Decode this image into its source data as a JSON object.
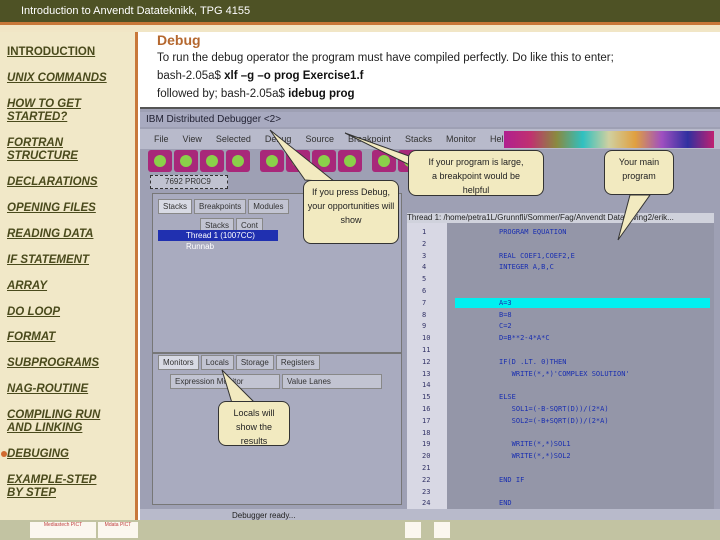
{
  "header": {
    "title": "Introduction to Anvendt Datateknikk, TPG 4155"
  },
  "sidebar": {
    "items": [
      "INTRODUCTION",
      "UNIX COMMANDS",
      "HOW TO GET STARTED?",
      "FORTRAN STRUCTURE",
      "DECLARATIONS",
      "OPENING FILES",
      "READING DATA",
      "IF STATEMENT",
      "ARRAY",
      "DO LOOP",
      "FORMAT",
      "SUBPROGRAMS",
      "NAG-ROUTINE",
      "COMPILING RUN AND LINKING",
      "DEBUGING",
      "EXAMPLE-STEP BY STEP"
    ],
    "active": "DEBUGING"
  },
  "main": {
    "title": "Debug",
    "line1": "To run the debug operator the program must have compiled perfectly. Do like this to enter;",
    "line2_prefix": "bash-2.05a$ ",
    "line2_cmd": "xlf –g –o prog Exercise1.f",
    "line3_prefix": "followed by; bash-2.05a$ ",
    "line3_cmd": "idebug prog"
  },
  "debugger": {
    "title": "IBM Distributed Debugger <2>",
    "menu": [
      "File",
      "View",
      "Selected",
      "Debug",
      "Source",
      "Breakpoint",
      "Stacks",
      "Monitor",
      "Help"
    ],
    "process": "7692 PR0C9",
    "left_tabs": [
      "Stacks",
      "Breakpoints",
      "Modules"
    ],
    "stack_cols": [
      "Stacks",
      "Cont"
    ],
    "thread": "Thread 1 (1007CC) Runnab",
    "bottom_tabs": [
      "Monitors",
      "Locals",
      "Storage",
      "Registers"
    ],
    "monitor_cols": [
      "Expression Monitor",
      "Value Lanes"
    ],
    "path": "Thread 1: /home/petra1L/Grunnfli/Sommer/Fag/Anvendt Data/Oving2/erik...",
    "code": [
      [
        "1",
        "PROGRAM EQUATION"
      ],
      [
        "2",
        ""
      ],
      [
        "3",
        "REAL COEF1,COEF2,E"
      ],
      [
        "4",
        "INTEGER A,B,C"
      ],
      [
        "5",
        ""
      ],
      [
        "6",
        ""
      ],
      [
        "7",
        "A=3"
      ],
      [
        "8",
        "B=8"
      ],
      [
        "9",
        "C=2"
      ],
      [
        "10",
        "D=B**2-4*A*C"
      ],
      [
        "11",
        ""
      ],
      [
        "12",
        "IF(D .LT. 0)THEN"
      ],
      [
        "13",
        "   WRITE(*,*)'COMPLEX SOLUTION'"
      ],
      [
        "14",
        ""
      ],
      [
        "15",
        "ELSE"
      ],
      [
        "16",
        "   SOL1=(-B-SQRT(D))/(2*A)"
      ],
      [
        "17",
        "   SOL2=(-B+SQRT(D))/(2*A)"
      ],
      [
        "18",
        ""
      ],
      [
        "19",
        "   WRITE(*,*)SOL1"
      ],
      [
        "20",
        "   WRITE(*,*)SOL2"
      ],
      [
        "21",
        ""
      ],
      [
        "22",
        "END IF"
      ],
      [
        "23",
        ""
      ],
      [
        "24",
        "END"
      ]
    ],
    "current_line": "7",
    "status": "Debugger ready..."
  },
  "callouts": {
    "debug": "If you press Debug, your opportunities will show",
    "breakpoint": "If your program is large, a breakpoint would be helpful",
    "main": "Your main program",
    "locals": "Locals will show the results"
  },
  "footer": {
    "logo1": "Mediastech PICT",
    "logo2": "Mdata PICT"
  }
}
